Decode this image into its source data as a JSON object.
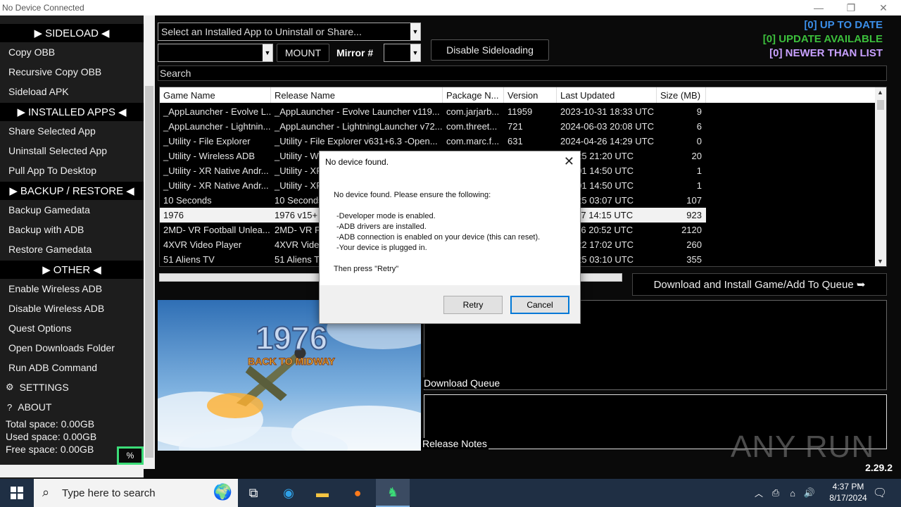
{
  "window": {
    "title": "No Device Connected"
  },
  "sidebar": {
    "sections": {
      "sideload": "SIDELOAD",
      "installed": "INSTALLED APPS",
      "backup": "BACKUP / RESTORE",
      "other": "OTHER"
    },
    "items": {
      "copy_obb": "Copy OBB",
      "recursive_copy_obb": "Recursive Copy OBB",
      "sideload_apk": "Sideload APK",
      "share_app": "Share Selected App",
      "uninstall_app": "Uninstall Selected App",
      "pull_app": "Pull App To Desktop",
      "backup_gamedata": "Backup Gamedata",
      "backup_adb": "Backup with ADB",
      "restore_gamedata": "Restore Gamedata",
      "enable_wireless": "Enable Wireless ADB",
      "disable_wireless": "Disable Wireless ADB",
      "quest_options": "Quest Options",
      "open_downloads": "Open Downloads Folder",
      "run_adb": "Run ADB Command",
      "settings": "SETTINGS",
      "about": "ABOUT"
    },
    "space": {
      "total": "Total space: 0.00GB",
      "used": "Used space: 0.00GB",
      "free": "Free space: 0.00GB"
    },
    "percent_label": "%"
  },
  "toolbar": {
    "installed_app_select": "Select an Installed App to Uninstall or Share...",
    "mount_label": "MOUNT",
    "mirror_label": "Mirror #",
    "disable_sideloading": "Disable Sideloading"
  },
  "status": {
    "up_to_date": "[0] UP TO DATE",
    "update_available": "[0] UPDATE AVAILABLE",
    "newer_than_list": "[0] NEWER THAN LIST",
    "colors": {
      "up_to_date": "#3b8ee8",
      "update_available": "#3cbf3c",
      "newer_than_list": "#c8a0ff"
    }
  },
  "search": {
    "placeholder": "Search"
  },
  "table": {
    "columns": [
      "Game Name",
      "Release Name",
      "Package N...",
      "Version",
      "Last Updated",
      "Size (MB)"
    ],
    "rows": [
      [
        "_AppLauncher - Evolve L...",
        "_AppLauncher - Evolve Launcher v119...",
        "com.jarjarb...",
        "11959",
        "2023-10-31 18:33 UTC",
        "9"
      ],
      [
        "_AppLauncher - Lightnin...",
        "_AppLauncher - LightningLauncher v72...",
        "com.threet...",
        "721",
        "2024-06-03 20:08 UTC",
        "6"
      ],
      [
        "_Utility - File Explorer",
        "_Utility - File Explorer v631+6.3 -Open...",
        "com.marc.f...",
        "631",
        "2024-04-26 14:29 UTC",
        "0"
      ],
      [
        "_Utility - Wireless ADB",
        "_Utility - W",
        "",
        "",
        "-08-25 21:20 UTC",
        "20"
      ],
      [
        "_Utility - XR Native Andr...",
        "_Utility - XR",
        "",
        "",
        "-07-01 14:50 UTC",
        "1"
      ],
      [
        "_Utility - XR Native Andr...",
        "_Utility - XR",
        "",
        "",
        "-07-01 14:50 UTC",
        "1"
      ],
      [
        "10 Seconds",
        "10 Seconds",
        "",
        "",
        "-08-25 03:07 UTC",
        "107"
      ],
      [
        "1976",
        "1976 v15+",
        "",
        "",
        "-11-07 14:15 UTC",
        "923"
      ],
      [
        "2MD- VR Football Unlea...",
        "2MD- VR F",
        "",
        "",
        "-11-06 20:52 UTC",
        "2120"
      ],
      [
        "4XVR Video Player",
        "4XVR Video",
        "",
        "",
        "-07-22 17:02 UTC",
        "260"
      ],
      [
        "51 Aliens TV",
        "51 Aliens T",
        "",
        "",
        "-08-25 03:10 UTC",
        "355"
      ]
    ],
    "selected_row": 7
  },
  "download": {
    "button_label": "Download and Install Game/Add To Queue ➥"
  },
  "hero": {
    "title_top": "1976",
    "title_bottom": "BACK TO MIDWAY"
  },
  "labels": {
    "download_queue": "Download Queue",
    "release_notes": "Release Notes"
  },
  "version": "2.29.2",
  "watermark": "ANY RUN",
  "dialog": {
    "title": "No device found.",
    "intro": "No device found. Please ensure the following:",
    "lines": [
      "-Developer mode is enabled.",
      "-ADB drivers are installed.",
      "-ADB connection is enabled on your device (this can reset).",
      "-Your device is plugged in."
    ],
    "outro": "Then press \"Retry\"",
    "retry": "Retry",
    "cancel": "Cancel"
  },
  "taskbar": {
    "search_placeholder": "Type here to search",
    "time": "4:37 PM",
    "date": "8/17/2024"
  }
}
